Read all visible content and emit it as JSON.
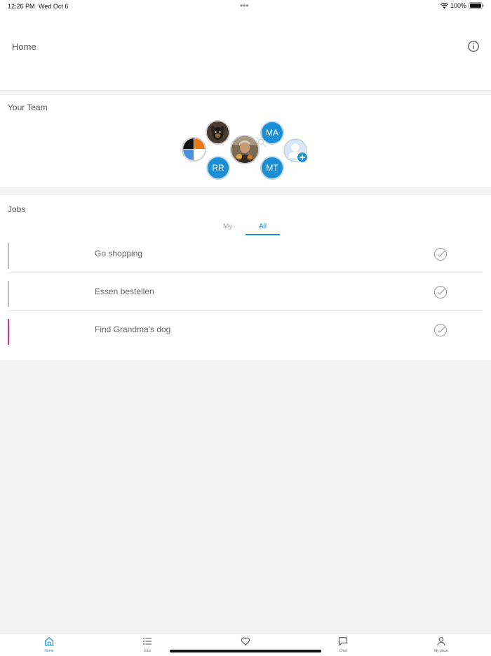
{
  "status": {
    "time": "12:26 PM",
    "date": "Wed Oct 6",
    "dots": "•••",
    "battery": "100%"
  },
  "header": {
    "title": "Home"
  },
  "team": {
    "title": "Your Team",
    "members": [
      {
        "initials": "MA"
      },
      {
        "initials": "RR"
      },
      {
        "initials": "MT"
      }
    ]
  },
  "jobs": {
    "title": "Jobs",
    "tabs": [
      {
        "label": "My"
      },
      {
        "label": "All"
      }
    ],
    "active_tab": "All",
    "items": [
      {
        "title": "Go shopping",
        "marker_color": "#bdbdbd"
      },
      {
        "title": "Essen bestellen",
        "marker_color": "#bdbdbd"
      },
      {
        "title": "Find Grandma's dog",
        "marker_color": "#e0357d"
      }
    ]
  },
  "nav": {
    "items": [
      {
        "label": "Home",
        "icon": "home-icon",
        "active": true
      },
      {
        "label": "Jobs",
        "icon": "list-icon",
        "active": false
      },
      {
        "label": "",
        "icon": "heart-icon",
        "active": false
      },
      {
        "label": "Chat",
        "icon": "chat-icon",
        "active": false
      },
      {
        "label": "My place",
        "icon": "person-icon",
        "active": false
      }
    ]
  },
  "colors": {
    "accent": "#1a8fd3",
    "urgent": "#e0357d",
    "neutral_marker": "#bdbdbd"
  }
}
